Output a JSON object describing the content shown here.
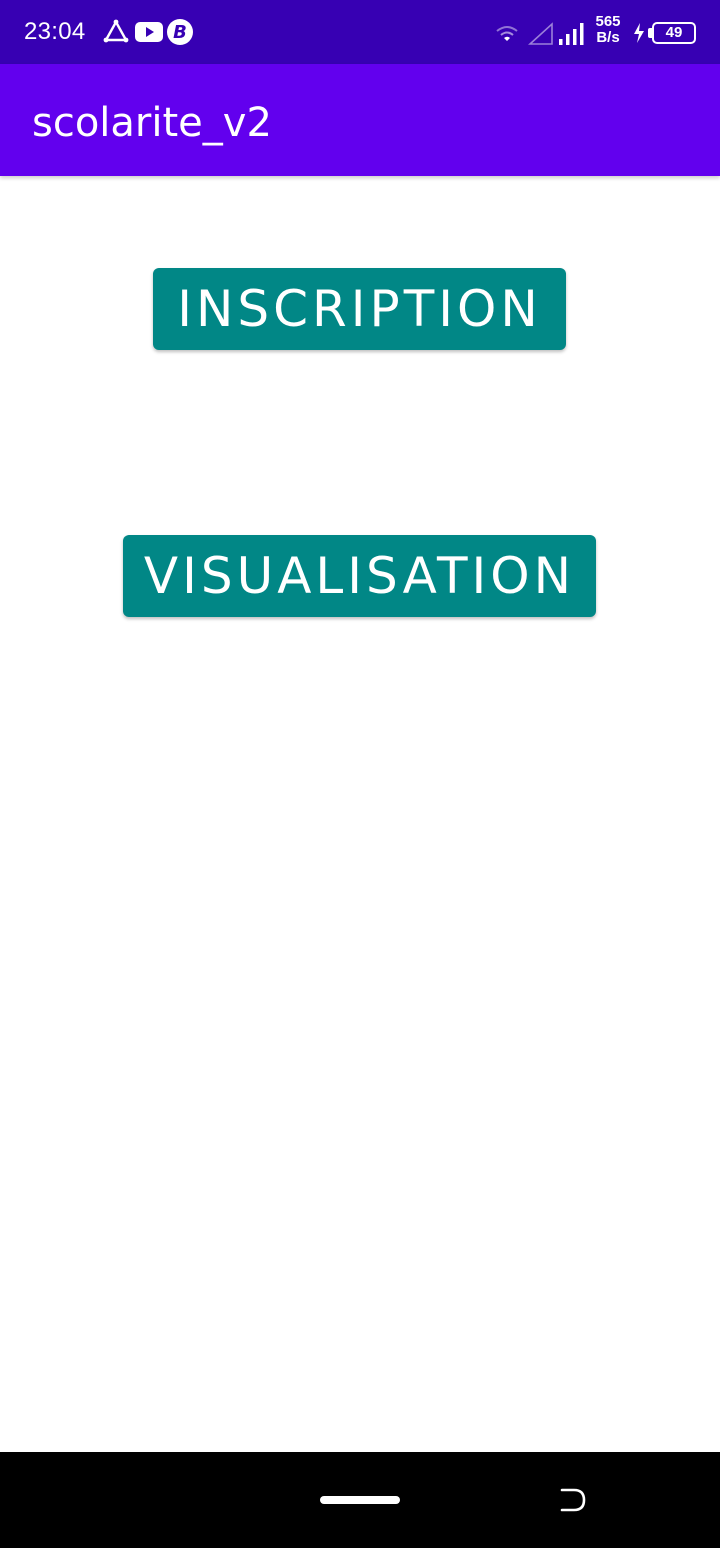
{
  "status_bar": {
    "time": "23:04",
    "left_icons": [
      "triangle-nodes-icon",
      "youtube-icon",
      "b-circle-icon"
    ],
    "net_speed_value": "565",
    "net_speed_unit": "B/s",
    "battery_level": "49",
    "right_icons": [
      "wifi-icon",
      "signal-empty-icon",
      "signal-icon",
      "charging-bolt-icon",
      "battery-icon"
    ]
  },
  "app_bar": {
    "title": "scolarite_v2"
  },
  "buttons": {
    "inscription": "INSCRIPTION",
    "visualisation": "VISUALISATION"
  },
  "colors": {
    "status_bar": "#3700b3",
    "app_bar": "#6200ee",
    "button": "#018786",
    "background": "#ffffff",
    "nav_bar": "#000000"
  },
  "nav_bar": {
    "icons": [
      "home-pill-icon",
      "back-icon"
    ]
  }
}
